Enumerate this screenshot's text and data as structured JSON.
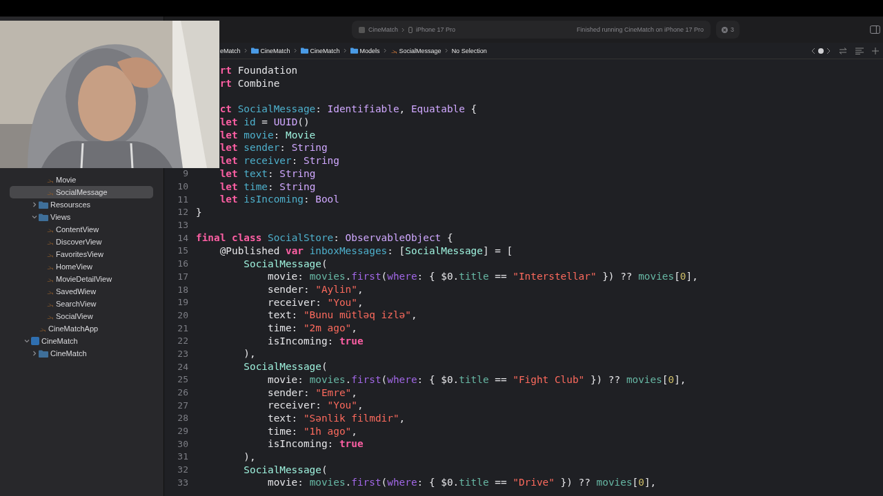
{
  "toolbar": {
    "scheme": "CineMatch",
    "device": "iPhone 17 Pro",
    "status": "Finished running CineMatch on iPhone 17 Pro",
    "issues": "3"
  },
  "breadcrumbs": [
    {
      "text": "eMatch",
      "kind": "plain"
    },
    {
      "text": "CineMatch",
      "kind": "folder"
    },
    {
      "text": "CineMatch",
      "kind": "folder"
    },
    {
      "text": "Models",
      "kind": "folder"
    },
    {
      "text": "SocialMessage",
      "kind": "swift"
    },
    {
      "text": "No Selection",
      "kind": "plain"
    }
  ],
  "sidebar": {
    "tree": [
      {
        "children": [
          {
            "children": [
              {
                "children": [
                  {
                    "label": "Movie",
                    "kind": "file",
                    "selected": false
                  },
                  {
                    "label": "SocialMessage",
                    "kind": "file",
                    "selected": true
                  }
                ]
              },
              {
                "label": "Resoursces",
                "kind": "folder",
                "expanded": false,
                "selected": false
              },
              {
                "label": "Views",
                "kind": "folder",
                "expanded": true,
                "selected": false,
                "children": [
                  {
                    "label": "ContentView",
                    "kind": "file",
                    "selected": false
                  },
                  {
                    "label": "DiscoverView",
                    "kind": "file",
                    "selected": false
                  },
                  {
                    "label": "FavoritesView",
                    "kind": "file",
                    "selected": false
                  },
                  {
                    "label": "HomeView",
                    "kind": "file",
                    "selected": false
                  },
                  {
                    "label": "MovieDetailView",
                    "kind": "file",
                    "selected": false
                  },
                  {
                    "label": "SavedWiew",
                    "kind": "file",
                    "selected": false
                  },
                  {
                    "label": "SearchView",
                    "kind": "file",
                    "selected": false
                  },
                  {
                    "label": "SocialView",
                    "kind": "file",
                    "selected": false
                  }
                ]
              },
              {
                "label": "CineMatchApp",
                "kind": "file",
                "selected": false
              }
            ]
          },
          {
            "label": "CineMatch",
            "kind": "project",
            "expanded": true,
            "selected": false,
            "children": [
              {
                "label": "CineMatch",
                "kind": "folder",
                "expanded": false,
                "selected": false
              }
            ]
          }
        ]
      }
    ]
  },
  "editor": {
    "lines": [
      {
        "tokens": [
          {
            "kind": "kw",
            "text": "    rt"
          },
          {
            "kind": "plain",
            "text": " Foundation"
          }
        ]
      },
      {
        "tokens": [
          {
            "kind": "kw",
            "text": "    rt"
          },
          {
            "kind": "plain",
            "text": " Combine"
          }
        ]
      },
      {
        "blank_above": true,
        "tokens": [
          {
            "kind": "kw",
            "text": "    ct"
          },
          {
            "kind": "decl",
            "text": " SocialMessage"
          },
          {
            "kind": "plain",
            "text": ": "
          },
          {
            "kind": "type",
            "text": "Identifiable"
          },
          {
            "kind": "plain",
            "text": ", "
          },
          {
            "kind": "type",
            "text": "Equatable"
          },
          {
            "kind": "plain",
            "text": " {"
          }
        ]
      },
      {
        "tokens": [
          {
            "kind": "kw",
            "text": "    let"
          },
          {
            "kind": "decl",
            "text": " id"
          },
          {
            "kind": "plain",
            "text": " = "
          },
          {
            "kind": "type",
            "text": "UUID"
          },
          {
            "kind": "plain",
            "text": "()"
          }
        ]
      },
      {
        "tokens": [
          {
            "kind": "kw",
            "text": "    let"
          },
          {
            "kind": "decl",
            "text": " movie"
          },
          {
            "kind": "plain",
            "text": ": "
          },
          {
            "kind": "ptype",
            "text": "Movie"
          }
        ]
      },
      {
        "tokens": [
          {
            "kind": "kw",
            "text": "    let"
          },
          {
            "kind": "decl",
            "text": " sender"
          },
          {
            "kind": "plain",
            "text": ": "
          },
          {
            "kind": "type",
            "text": "String"
          }
        ]
      },
      {
        "tokens": [
          {
            "kind": "kw",
            "text": "    let"
          },
          {
            "kind": "decl",
            "text": " receiver"
          },
          {
            "kind": "plain",
            "text": ": "
          },
          {
            "kind": "type",
            "text": "String"
          }
        ]
      },
      {
        "number": "9",
        "tokens": [
          {
            "kind": "kw",
            "text": "    let"
          },
          {
            "kind": "decl",
            "text": " text"
          },
          {
            "kind": "plain",
            "text": ": "
          },
          {
            "kind": "type",
            "text": "String"
          }
        ]
      },
      {
        "number": "10",
        "tokens": [
          {
            "kind": "kw",
            "text": "    let"
          },
          {
            "kind": "decl",
            "text": " time"
          },
          {
            "kind": "plain",
            "text": ": "
          },
          {
            "kind": "type",
            "text": "String"
          }
        ]
      },
      {
        "number": "11",
        "tokens": [
          {
            "kind": "kw",
            "text": "    let"
          },
          {
            "kind": "decl",
            "text": " isIncoming"
          },
          {
            "kind": "plain",
            "text": ": "
          },
          {
            "kind": "type",
            "text": "Bool"
          }
        ]
      },
      {
        "number": "12",
        "tokens": [
          {
            "kind": "plain",
            "text": "}"
          }
        ]
      },
      {
        "number": "13"
      },
      {
        "number": "14",
        "tokens": [
          {
            "kind": "kw",
            "text": "final class"
          },
          {
            "kind": "decl",
            "text": " SocialStore"
          },
          {
            "kind": "plain",
            "text": ": "
          },
          {
            "kind": "type",
            "text": "ObservableObject"
          },
          {
            "kind": "plain",
            "text": " {"
          }
        ]
      },
      {
        "number": "15",
        "tokens": [
          {
            "kind": "plain",
            "text": "    @Published "
          },
          {
            "kind": "kw",
            "text": "var"
          },
          {
            "kind": "decl",
            "text": " inboxMessages"
          },
          {
            "kind": "plain",
            "text": ": ["
          },
          {
            "kind": "ptype",
            "text": "SocialMessage"
          },
          {
            "kind": "plain",
            "text": "] = ["
          }
        ]
      },
      {
        "number": "16",
        "tokens": [
          {
            "kind": "ptype",
            "text": "        SocialMessage"
          },
          {
            "kind": "plain",
            "text": "("
          }
        ]
      },
      {
        "number": "17",
        "tokens": [
          {
            "kind": "plain",
            "text": "            movie: "
          },
          {
            "kind": "prop",
            "text": "movies"
          },
          {
            "kind": "plain",
            "text": "."
          },
          {
            "kind": "method",
            "text": "first"
          },
          {
            "kind": "plain",
            "text": "("
          },
          {
            "kind": "method",
            "text": "where"
          },
          {
            "kind": "plain",
            "text": ": { $0."
          },
          {
            "kind": "prop",
            "text": "title"
          },
          {
            "kind": "plain",
            "text": " == "
          },
          {
            "kind": "str",
            "text": "\"Interstellar\""
          },
          {
            "kind": "plain",
            "text": " }) ?? "
          },
          {
            "kind": "prop",
            "text": "movies"
          },
          {
            "kind": "plain",
            "text": "["
          },
          {
            "kind": "num",
            "text": "0"
          },
          {
            "kind": "plain",
            "text": "],"
          }
        ]
      },
      {
        "number": "18",
        "tokens": [
          {
            "kind": "plain",
            "text": "            sender: "
          },
          {
            "kind": "str",
            "text": "\"Aylin\""
          },
          {
            "kind": "plain",
            "text": ","
          }
        ]
      },
      {
        "number": "19",
        "tokens": [
          {
            "kind": "plain",
            "text": "            receiver: "
          },
          {
            "kind": "str",
            "text": "\"You\""
          },
          {
            "kind": "plain",
            "text": ","
          }
        ]
      },
      {
        "number": "20",
        "tokens": [
          {
            "kind": "plain",
            "text": "            text: "
          },
          {
            "kind": "str",
            "text": "\"Bunu mütləq izlə\""
          },
          {
            "kind": "plain",
            "text": ","
          }
        ]
      },
      {
        "number": "21",
        "tokens": [
          {
            "kind": "plain",
            "text": "            time: "
          },
          {
            "kind": "str",
            "text": "\"2m ago\""
          },
          {
            "kind": "plain",
            "text": ","
          }
        ]
      },
      {
        "number": "22",
        "tokens": [
          {
            "kind": "plain",
            "text": "            isIncoming: "
          },
          {
            "kind": "kw",
            "text": "true"
          }
        ]
      },
      {
        "number": "23",
        "tokens": [
          {
            "kind": "plain",
            "text": "        ),"
          }
        ]
      },
      {
        "number": "24",
        "tokens": [
          {
            "kind": "ptype",
            "text": "        SocialMessage"
          },
          {
            "kind": "plain",
            "text": "("
          }
        ]
      },
      {
        "number": "25",
        "tokens": [
          {
            "kind": "plain",
            "text": "            movie: "
          },
          {
            "kind": "prop",
            "text": "movies"
          },
          {
            "kind": "plain",
            "text": "."
          },
          {
            "kind": "method",
            "text": "first"
          },
          {
            "kind": "plain",
            "text": "("
          },
          {
            "kind": "method",
            "text": "where"
          },
          {
            "kind": "plain",
            "text": ": { $0."
          },
          {
            "kind": "prop",
            "text": "title"
          },
          {
            "kind": "plain",
            "text": " == "
          },
          {
            "kind": "str",
            "text": "\"Fight Club\""
          },
          {
            "kind": "plain",
            "text": " }) ?? "
          },
          {
            "kind": "prop",
            "text": "movies"
          },
          {
            "kind": "plain",
            "text": "["
          },
          {
            "kind": "num",
            "text": "0"
          },
          {
            "kind": "plain",
            "text": "],"
          }
        ]
      },
      {
        "number": "26",
        "tokens": [
          {
            "kind": "plain",
            "text": "            sender: "
          },
          {
            "kind": "str",
            "text": "\"Emre\""
          },
          {
            "kind": "plain",
            "text": ","
          }
        ]
      },
      {
        "number": "27",
        "tokens": [
          {
            "kind": "plain",
            "text": "            receiver: "
          },
          {
            "kind": "str",
            "text": "\"You\""
          },
          {
            "kind": "plain",
            "text": ","
          }
        ]
      },
      {
        "number": "28",
        "tokens": [
          {
            "kind": "plain",
            "text": "            text: "
          },
          {
            "kind": "str",
            "text": "\"Sənlik filmdir\""
          },
          {
            "kind": "plain",
            "text": ","
          }
        ]
      },
      {
        "number": "29",
        "tokens": [
          {
            "kind": "plain",
            "text": "            time: "
          },
          {
            "kind": "str",
            "text": "\"1h ago\""
          },
          {
            "kind": "plain",
            "text": ","
          }
        ]
      },
      {
        "number": "30",
        "tokens": [
          {
            "kind": "plain",
            "text": "            isIncoming: "
          },
          {
            "kind": "kw",
            "text": "true"
          }
        ]
      },
      {
        "number": "31",
        "tokens": [
          {
            "kind": "plain",
            "text": "        ),"
          }
        ]
      },
      {
        "number": "32",
        "tokens": [
          {
            "kind": "ptype",
            "text": "        SocialMessage"
          },
          {
            "kind": "plain",
            "text": "("
          }
        ]
      },
      {
        "number": "33",
        "tokens": [
          {
            "kind": "plain",
            "text": "            movie: "
          },
          {
            "kind": "prop",
            "text": "movies"
          },
          {
            "kind": "plain",
            "text": "."
          },
          {
            "kind": "method",
            "text": "first"
          },
          {
            "kind": "plain",
            "text": "("
          },
          {
            "kind": "method",
            "text": "where"
          },
          {
            "kind": "plain",
            "text": ": { $0."
          },
          {
            "kind": "prop",
            "text": "title"
          },
          {
            "kind": "plain",
            "text": " == "
          },
          {
            "kind": "str",
            "text": "\"Drive\""
          },
          {
            "kind": "plain",
            "text": " }) ?? "
          },
          {
            "kind": "prop",
            "text": "movies"
          },
          {
            "kind": "plain",
            "text": "["
          },
          {
            "kind": "num",
            "text": "0"
          },
          {
            "kind": "plain",
            "text": "],"
          }
        ]
      }
    ]
  }
}
